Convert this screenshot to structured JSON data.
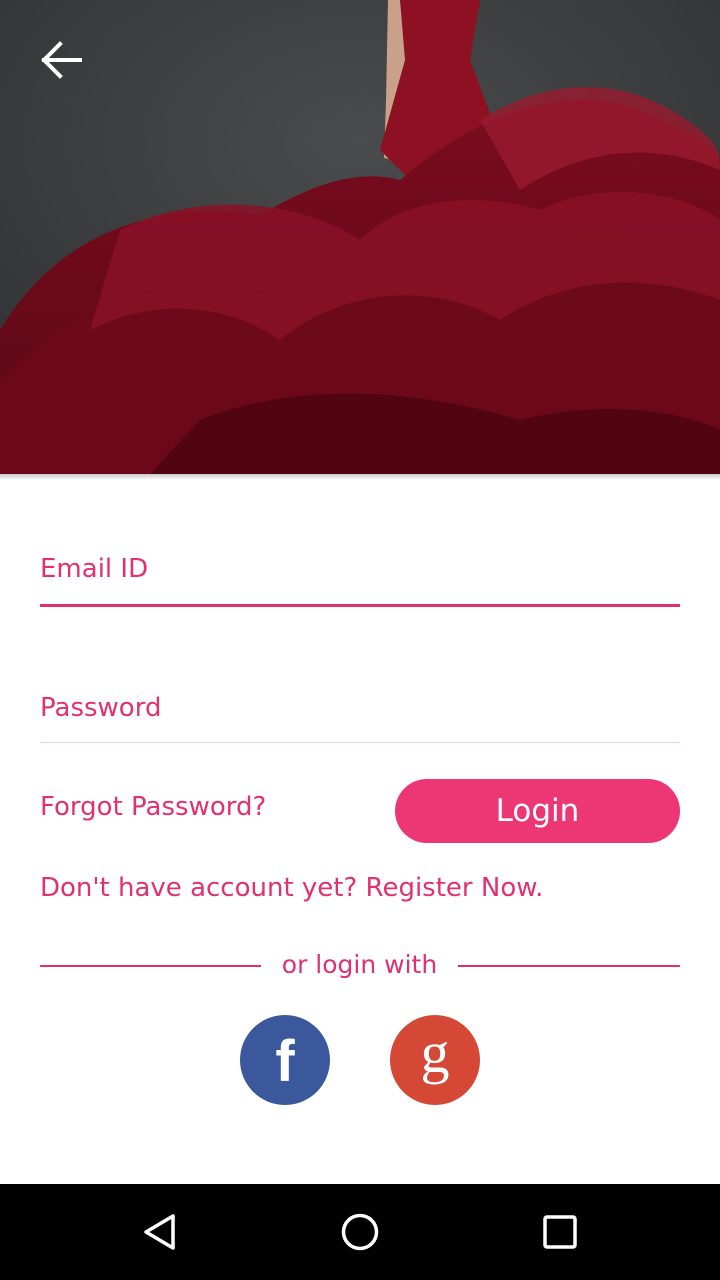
{
  "header": {
    "back_icon": "arrow-left-icon"
  },
  "form": {
    "email_placeholder": "Email ID",
    "email_value": "",
    "password_placeholder": "Password",
    "password_value": "",
    "forgot_label": "Forgot Password?",
    "login_label": "Login",
    "register_label": "Don't have account yet? Register Now."
  },
  "social": {
    "divider_text": "or login with",
    "facebook_glyph": "f",
    "google_glyph": "g"
  },
  "navbar": {
    "back_icon": "triangle-back-icon",
    "home_icon": "circle-home-icon",
    "recents_icon": "square-recents-icon"
  },
  "colors": {
    "accent": "#e3306f",
    "button": "#ec3774",
    "facebook": "#3b589c",
    "google": "#d64836"
  }
}
